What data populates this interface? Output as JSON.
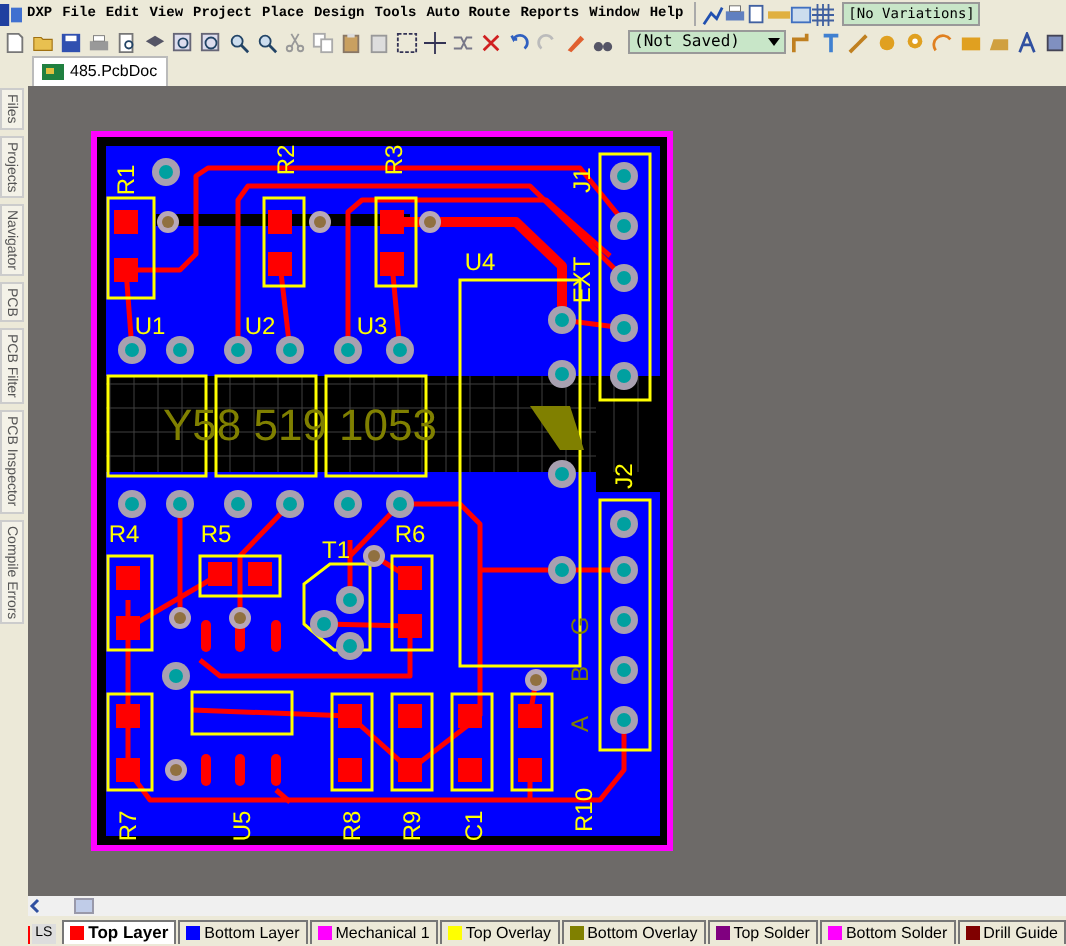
{
  "menu": [
    {
      "label": "DXP"
    },
    {
      "label": "File"
    },
    {
      "label": "Edit"
    },
    {
      "label": "View"
    },
    {
      "label": "Project"
    },
    {
      "label": "Place"
    },
    {
      "label": "Design"
    },
    {
      "label": "Tools"
    },
    {
      "label": "Auto Route"
    },
    {
      "label": "Reports"
    },
    {
      "label": "Window"
    },
    {
      "label": "Help"
    }
  ],
  "variations_combo": {
    "value": "[No Variations]"
  },
  "saved_combo": {
    "value": "(Not Saved)"
  },
  "document_tab": {
    "label": "485.PcbDoc"
  },
  "side_panels": [
    {
      "label": "Files"
    },
    {
      "label": "Projects"
    },
    {
      "label": "Navigator"
    },
    {
      "label": "PCB"
    },
    {
      "label": "PCB Filter"
    },
    {
      "label": "PCB Inspector"
    },
    {
      "label": "Compile Errors"
    }
  ],
  "pcb": {
    "designators": [
      "R1",
      "R2",
      "R3",
      "J1",
      "EXT",
      "U4",
      "U1",
      "U2",
      "U3",
      "J2",
      "R4",
      "R5",
      "T1",
      "R6",
      "G",
      "B",
      "A",
      "R7",
      "U5",
      "R8",
      "R9",
      "C1",
      "R10"
    ],
    "bottom_overlay_text": "Y58 519 1053"
  },
  "layer_bar": {
    "ls_label": "LS"
  },
  "layers": [
    {
      "label": "Top Layer",
      "color": "#ff0000",
      "selected": true
    },
    {
      "label": "Bottom Layer",
      "color": "#0000ff",
      "selected": false
    },
    {
      "label": "Mechanical 1",
      "color": "#ff00ff",
      "selected": false
    },
    {
      "label": "Top Overlay",
      "color": "#ffff00",
      "selected": false
    },
    {
      "label": "Bottom Overlay",
      "color": "#808000",
      "selected": false
    },
    {
      "label": "Top Solder",
      "color": "#800080",
      "selected": false
    },
    {
      "label": "Bottom Solder",
      "color": "#ff00ff",
      "selected": false
    },
    {
      "label": "Drill Guide",
      "color": "#800000",
      "selected": false
    }
  ]
}
